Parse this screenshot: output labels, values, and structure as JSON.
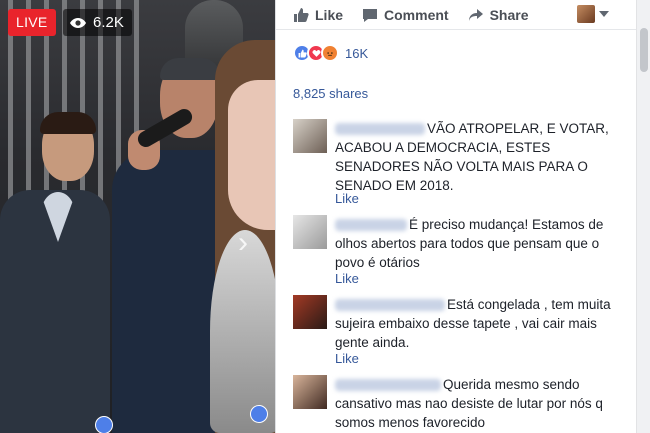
{
  "video": {
    "live_label": "LIVE",
    "viewer_count": "6.2K"
  },
  "actions": {
    "like_label": "Like",
    "comment_label": "Comment",
    "share_label": "Share"
  },
  "reactions": {
    "types": [
      "like-icon",
      "love-icon",
      "angry-icon"
    ],
    "count": "16K"
  },
  "shares_text": "8,825 shares",
  "comments": [
    {
      "text": "VÃO ATROPELAR, E VOTAR, ACABOU A DEMOCRACIA, ESTES SENADORES NÃO VOLTA MAIS PARA O SENADO EM 2018.",
      "like_label": "Like"
    },
    {
      "text": "É preciso mudança! Estamos de olhos abertos para todos que pensam que o povo é otários",
      "like_label": "Like"
    },
    {
      "text": "Está congelada , tem muita sujeira embaixo desse tapete , vai cair mais gente ainda.",
      "like_label": "Like"
    },
    {
      "text": "Querida mesmo sendo cansativo mas nao desiste de lutar por nós q somos menos favorecido",
      "like_label": ""
    }
  ],
  "colors": {
    "live_red": "#e9242c",
    "link_blue": "#365899",
    "like_blue": "#4e7fe8"
  }
}
